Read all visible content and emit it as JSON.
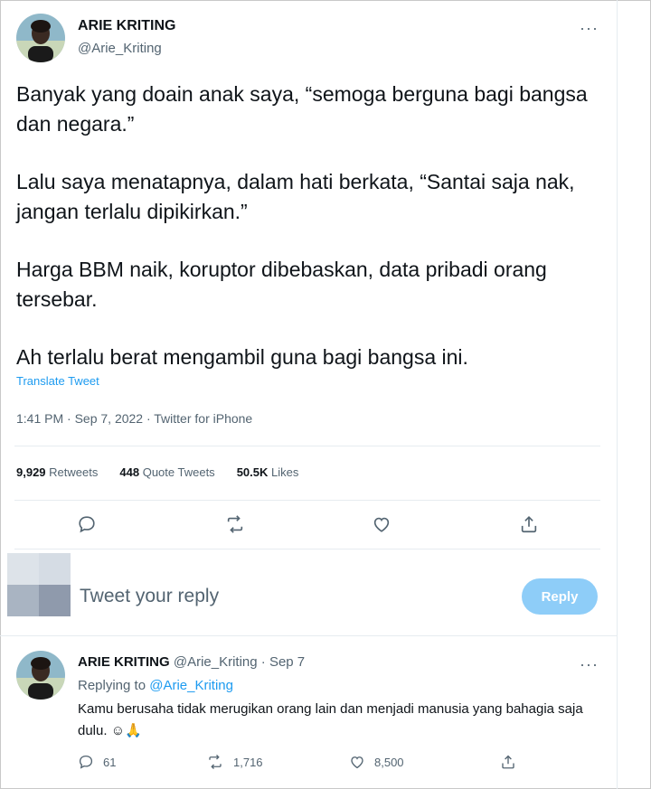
{
  "tweet": {
    "author_name": "ARIE KRITING",
    "author_handle": "@Arie_Kriting",
    "more_label": "···",
    "paragraphs": [
      "Banyak yang doain anak saya, “semoga berguna bagi bangsa dan negara.”",
      "Lalu saya menatapnya, dalam hati berkata, “Santai saja nak, jangan terlalu dipikirkan.”",
      "Harga BBM naik, koruptor dibebaskan, data pribadi orang tersebar.",
      "Ah terlalu berat mengambil guna bagi bangsa ini."
    ],
    "translate_label": "Translate Tweet",
    "meta": "1:41 PM · Sep 7, 2022 · Twitter for iPhone",
    "stats": {
      "retweets_count": "9,929",
      "retweets_label": "Retweets",
      "quotes_count": "448",
      "quotes_label": "Quote Tweets",
      "likes_count": "50.5K",
      "likes_label": "Likes"
    },
    "actions": [
      "reply-icon",
      "retweet-icon",
      "like-icon",
      "share-icon"
    ]
  },
  "composer": {
    "placeholder": "Tweet your reply",
    "button_label": "Reply",
    "button_color": "#8ecdf8"
  },
  "reply": {
    "author_name": "ARIE KRITING",
    "author_handle": "@Arie_Kriting",
    "separator": "·",
    "date": "Sep 7",
    "replying_prefix": "Replying to",
    "replying_mention": "@Arie_Kriting",
    "text": "Kamu berusaha tidak merugikan orang lain dan menjadi manusia yang bahagia saja dulu. ☺🙏",
    "more_label": "···",
    "reply_count": "61",
    "retweet_count": "1,716",
    "like_count": "8,500"
  },
  "colors": {
    "accent": "#1d9bf0",
    "muted": "#536471",
    "text": "#0f1419",
    "divider": "#e6ecf0"
  }
}
